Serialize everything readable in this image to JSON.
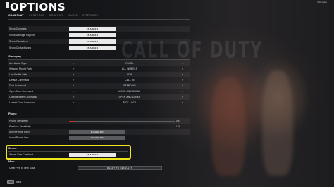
{
  "header": {
    "title": "OPTIONS",
    "top_right_line1": "ESC Back",
    "top_right_line2": ""
  },
  "tabs": [
    {
      "label": "GAMEPLAY",
      "active": true
    },
    {
      "label": "CONTROLS",
      "active": false
    },
    {
      "label": "GRAPHICS",
      "active": false
    },
    {
      "label": "AUDIO",
      "active": false
    },
    {
      "label": "INTERFACE",
      "active": false
    }
  ],
  "background_text": "CALL OF DUTY",
  "top_rows": [
    {
      "label": "Show Compass",
      "value": "ENABLED"
    },
    {
      "label": "Show Damage Popcorn",
      "value": "ENABLED"
    },
    {
      "label": "Show Hitmarkers",
      "value": "ENABLED"
    },
    {
      "label": "Show Contact Icons",
      "value": "ENABLED"
    }
  ],
  "gameplay_section": {
    "title": "Gameplay",
    "rows": [
      {
        "label": "Aim Assist Style",
        "value": "PANEL"
      },
      {
        "label": "Weapon Mount Path",
        "value": "ALL WHEELS"
      },
      {
        "label": "Low Profile Style",
        "value": "LOW"
      },
      {
        "label": "Default Command",
        "value": "CALL IN"
      },
      {
        "label": "Dive Command",
        "value": "STAND UP"
      },
      {
        "label": "Open Door Command",
        "value": "MOVE AND CLEAR"
      },
      {
        "label": "Collected Item Command",
        "value": "OPEN AND CLEAR"
      },
      {
        "label": "Locked Door Command",
        "value": "PICK LOCK"
      }
    ]
  },
  "phone_section": {
    "title": "Phone",
    "sliders": [
      {
        "label": "Phone Sensitivity",
        "value": "0.8",
        "fill": 0.05
      },
      {
        "label": "Freelook Sensitivity",
        "value": "1.00",
        "fill": 0.1
      }
    ],
    "toggles": [
      {
        "label": "Invert Phone Pitch",
        "value": "DISABLED"
      },
      {
        "label": "Invert Phone Yaw",
        "value": "DISABLED"
      }
    ]
  },
  "server_section": {
    "title": "Server",
    "rows": [
      {
        "label": "Server Side Checkout",
        "value": "ENABLED"
      }
    ]
  },
  "misc_section": {
    "title": "Misc",
    "rows": [
      {
        "label": "Clear Pins to Item Data",
        "value": "RESET TO DEFAULTS"
      }
    ]
  },
  "footer": {
    "key": "ESC",
    "label": "Back"
  },
  "colors": {
    "highlight": "#f0e51c",
    "accent": "#c8362b"
  }
}
